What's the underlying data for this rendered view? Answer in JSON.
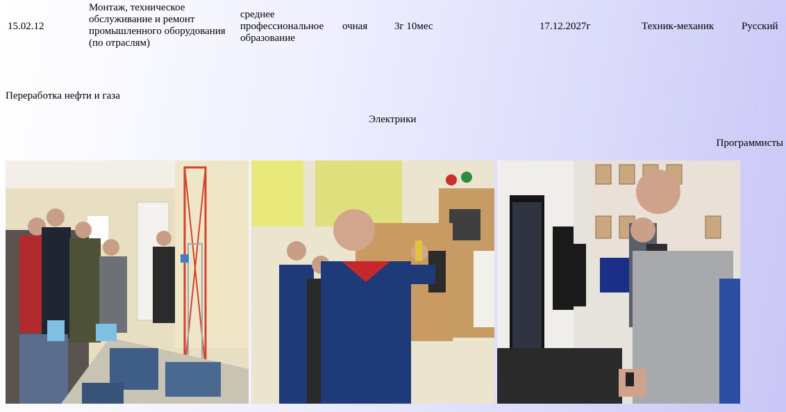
{
  "program_row": {
    "code": "15.02.12",
    "name": "Монтаж, техническое обслуживание и ремонт промышленного оборудования (по отраслям)",
    "level": "среднее профессиональное образование",
    "form": "очная",
    "duration": "3г 10мес",
    "accreditation_date": "17.12.2027г",
    "qualification": "Техник-механик",
    "language": "Русский"
  },
  "captions": {
    "oil": "Переработка нефти и газа",
    "electricians": "Электрики",
    "programmers": "Программисты"
  },
  "photos": [
    {
      "subject": "students-with-drilling-rig-model"
    },
    {
      "subject": "student-wiring-electrical-panel"
    },
    {
      "subject": "students-at-computers"
    }
  ],
  "colors": {
    "uniform_blue": "#1f3a78",
    "collar_red": "#c5282b",
    "background_right": "#c9c6f6"
  }
}
